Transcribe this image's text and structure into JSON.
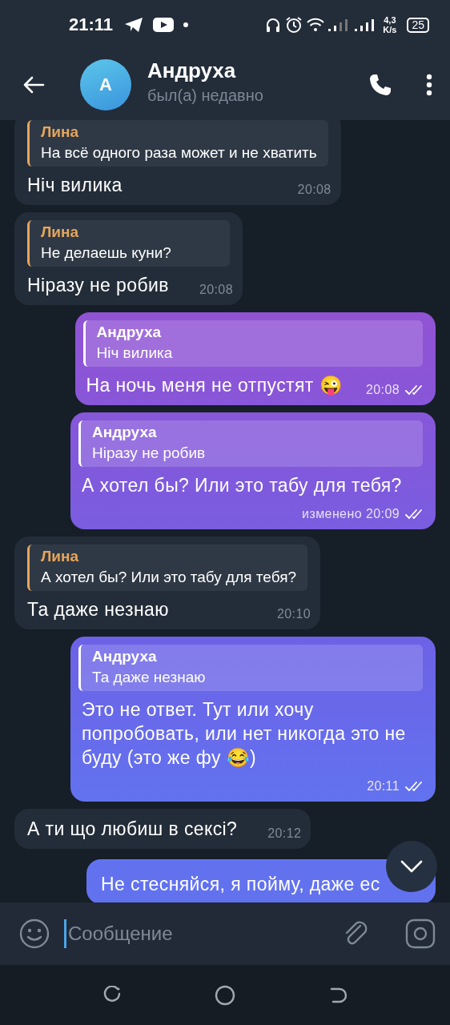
{
  "status_bar": {
    "time": "21:11",
    "speed_value": "4,3",
    "speed_unit": "K/s",
    "battery": "25"
  },
  "header": {
    "avatar_letter": "A",
    "name": "Андруха",
    "status": "был(а) недавно"
  },
  "messages": [
    {
      "kind": "in",
      "reply": {
        "author": "Лина",
        "text": "На всё одного раза может и не хватить"
      },
      "text": "Ніч вилика",
      "time": "20:08"
    },
    {
      "kind": "in",
      "reply": {
        "author": "Лина",
        "text": "Не делаешь куни?"
      },
      "text": "Ніразу не робив",
      "time": "20:08"
    },
    {
      "kind": "out",
      "reply": {
        "author": "Андруха",
        "text": "Ніч вилика"
      },
      "text": "На ночь меня не отпустят 😜",
      "time": "20:08",
      "read": true
    },
    {
      "kind": "out",
      "reply": {
        "author": "Андруха",
        "text": "Ніразу не робив"
      },
      "text": "А хотел бы? Или это табу для тебя?",
      "edited": "изменено",
      "time": "20:09",
      "read": true
    },
    {
      "kind": "in",
      "reply": {
        "author": "Лина",
        "text": "А хотел бы? Или это табу для тебя?"
      },
      "text": "Та даже незнаю",
      "time": "20:10"
    },
    {
      "kind": "out",
      "reply": {
        "author": "Андруха",
        "text": "Та даже незнаю"
      },
      "text": "Это не ответ. Тут или хочу попробовать, или нет никогда это не буду (это же фу 😂)",
      "time": "20:11",
      "read": true
    },
    {
      "kind": "in",
      "text": "А ти що любиш в сексі?",
      "time": "20:12"
    },
    {
      "kind": "out",
      "text": "Не стесняйся, я пойму, даже ес"
    }
  ],
  "input": {
    "placeholder": "Сообщение"
  }
}
